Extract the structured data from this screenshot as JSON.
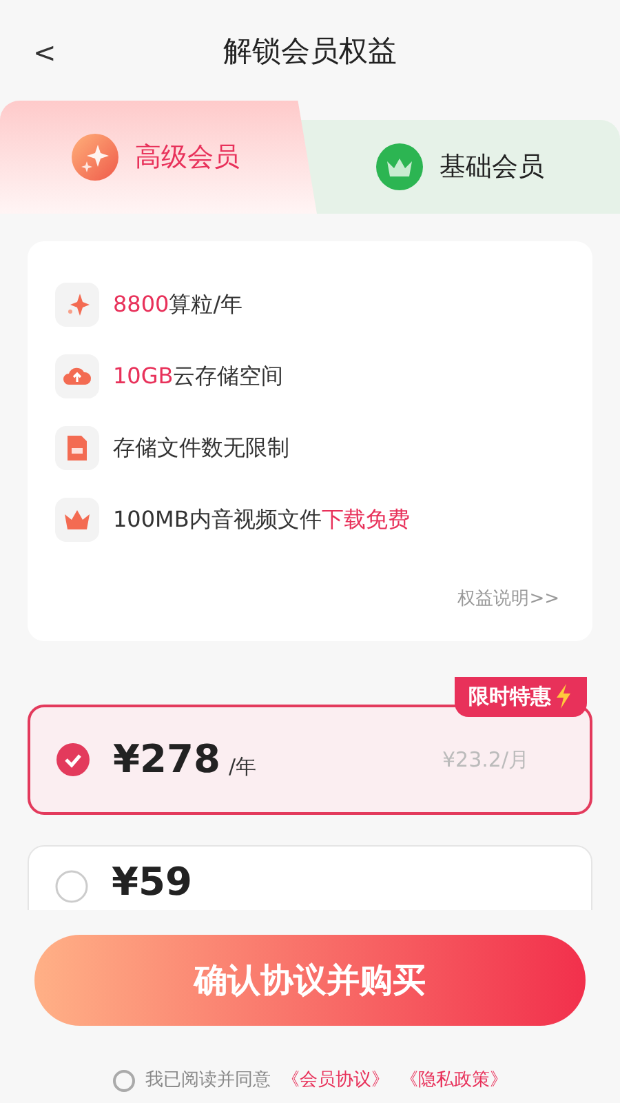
{
  "header": {
    "back": "<",
    "title": "解锁会员权益"
  },
  "tabs": [
    {
      "label": "高级会员",
      "selected": true,
      "kind": "premium"
    },
    {
      "label": "基础会员",
      "selected": false,
      "kind": "basic"
    }
  ],
  "benefits": [
    {
      "kind": "sparkle",
      "parts": [
        {
          "text": "8800",
          "highlight": true
        },
        {
          "text": "算粒/年",
          "highlight": false
        }
      ]
    },
    {
      "kind": "cloud",
      "parts": [
        {
          "text": "10GB",
          "highlight": true
        },
        {
          "text": "云存储空间",
          "highlight": false
        }
      ]
    },
    {
      "kind": "file",
      "parts": [
        {
          "text": "存储文件数无限制",
          "highlight": false
        }
      ]
    },
    {
      "kind": "crown",
      "parts": [
        {
          "text": "100MB内音视频文件",
          "highlight": false
        },
        {
          "text": "下载免费",
          "highlight": true
        }
      ]
    }
  ],
  "benefits_link": "权益说明>>",
  "plans": [
    {
      "price": "¥278",
      "unit": "/年",
      "monthly": "¥23.2/月",
      "badge": "限时特惠",
      "selected": true
    },
    {
      "price": "¥59",
      "selected": false
    }
  ],
  "buy_button": "确认协议并购买",
  "agreement": {
    "checked": false,
    "text": "我已阅读并同意",
    "links": [
      "《会员协议》",
      "《隐私政策》"
    ]
  }
}
